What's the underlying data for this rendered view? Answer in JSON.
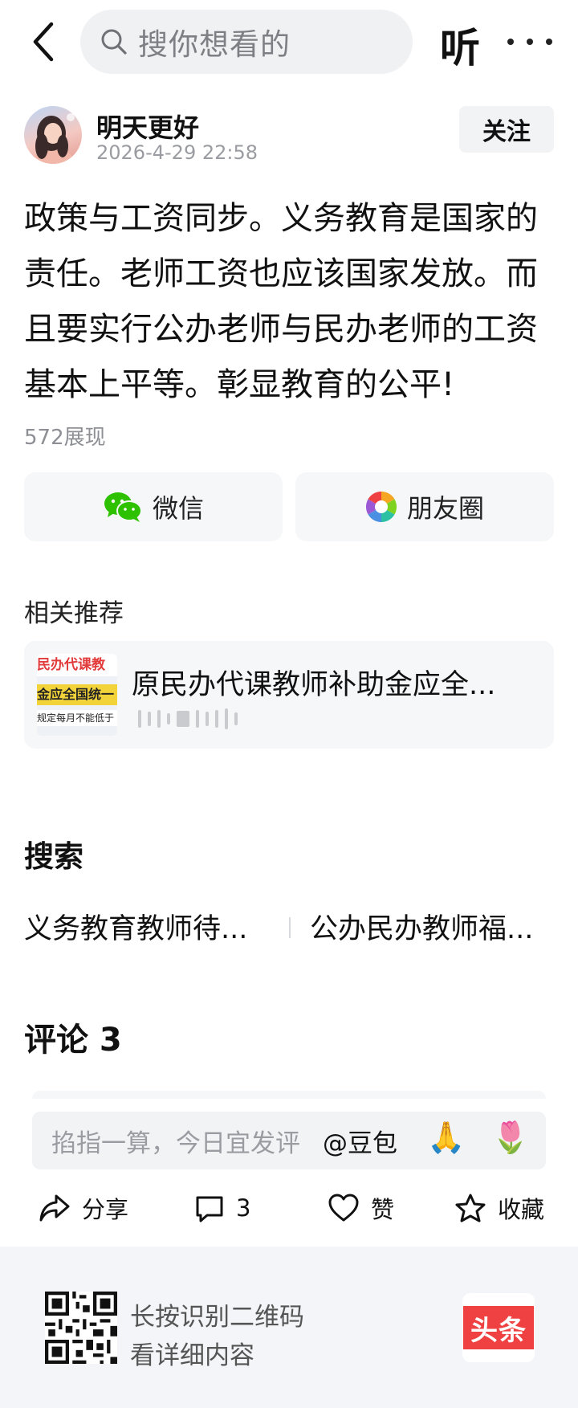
{
  "topbar": {
    "search_placeholder": "搜你想看的",
    "listen_label": "听"
  },
  "author": {
    "name": "明天更好",
    "timestamp": "2026-4-29 22:58",
    "follow_label": "关注"
  },
  "post": {
    "text": "政策与工资同步。义务教育是国家的责任。老师工资也应该国家发放。而且要实行公办老师与民办老师的工资基本上平等。彰显教育的公平!",
    "views": "572展现"
  },
  "share": {
    "wechat_label": "微信",
    "moments_label": "朋友圈"
  },
  "related": {
    "section_title": "相关推荐",
    "item_title": "原民办代课教师补助金应全...",
    "thumb_line1": "民办代课教",
    "thumb_line2": "金应全国统一",
    "thumb_line3": "规定每月不能低于"
  },
  "search_section": {
    "title": "搜索",
    "suggestions": [
      "义务教育教师待...",
      "公办民办教师福..."
    ]
  },
  "comments": {
    "title": "评论 3",
    "input_placeholder": "掐指一算，今日宜发评",
    "mention": "@豆包",
    "emoji1": "🙏",
    "emoji2": "🌷"
  },
  "actions": {
    "share_label": "分享",
    "comment_count": "3",
    "like_label": "赞",
    "favorite_label": "收藏"
  },
  "footer": {
    "line1": "长按识别二维码",
    "line2": "看详细内容",
    "logo_text": "头条"
  },
  "colors": {
    "brand_red": "#f04142",
    "wechat_green": "#2dc100"
  }
}
